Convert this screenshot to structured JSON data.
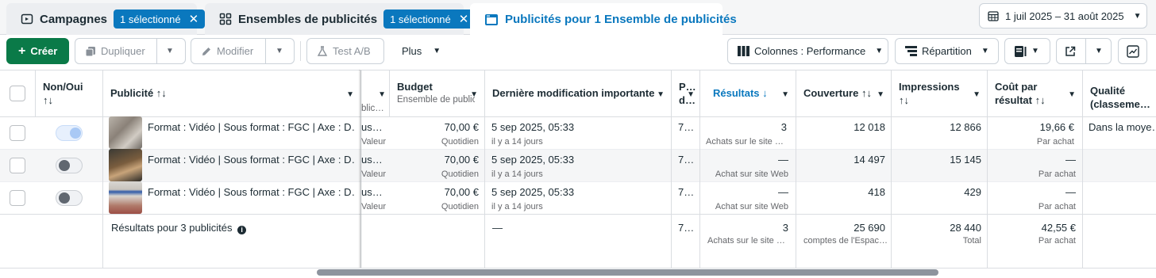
{
  "tabs": {
    "campaigns": {
      "label": "Campagnes",
      "chip": "1 sélectionné"
    },
    "adsets": {
      "label": "Ensembles de publicités",
      "chip": "1 sélectionné"
    },
    "ads": {
      "label": "Publicités pour 1 Ensemble de publicités"
    }
  },
  "date_range": "1 juil 2025 – 31 août 2025",
  "toolbar": {
    "create": "Créer",
    "duplicate": "Dupliquer",
    "edit": "Modifier",
    "ab_test": "Test A/B",
    "more": "Plus",
    "columns": "Colonnes : Performance",
    "breakdown": "Répartition"
  },
  "columns": {
    "onoff": "Non/Oui",
    "onoff_sort": "↑↓",
    "ad": "Publicité ↑↓",
    "hidden_sub": "blic…",
    "budget": "Budget",
    "budget_sub": "Ensemble de public…",
    "last_edit": "Dernière modification importante",
    "p_col_1": "P…",
    "p_col_2": "d…",
    "results": "Résultats ↓",
    "reach": "Couverture ↑↓",
    "impressions": "Impressions",
    "impressions_sort": "↑↓",
    "cost_per_result": "Coût par",
    "cost_per_result_2": "résultat ↑↓",
    "quality": "Qualité",
    "quality_2": "(classeme…"
  },
  "rows": [
    {
      "name": "Format : Vidéo | Sous format : FGC | Axe : D…",
      "hidden": "us…",
      "hidden_sub": "Valeur",
      "budget": "70,00 €",
      "budget_sub": "Quotidien",
      "last_edit": "5 sep 2025, 05:33",
      "last_edit_sub": "il y a 14 jours",
      "p_col": "7…",
      "results": "3",
      "results_sub": "Achats sur le site …",
      "reach": "12 018",
      "impressions": "12 866",
      "cpr": "19,66 €",
      "cpr_sub": "Par achat",
      "quality": "Dans la moye…",
      "on": true
    },
    {
      "name": "Format : Vidéo | Sous format : FGC | Axe : D…",
      "hidden": "us…",
      "hidden_sub": "Valeur",
      "budget": "70,00 €",
      "budget_sub": "Quotidien",
      "last_edit": "5 sep 2025, 05:33",
      "last_edit_sub": "il y a 14 jours",
      "p_col": "7…",
      "results": "—",
      "results_sub": "Achat sur site Web",
      "reach": "14 497",
      "impressions": "15 145",
      "cpr": "—",
      "cpr_sub": "Par achat",
      "quality": "",
      "on": false
    },
    {
      "name": "Format : Vidéo | Sous format : FGC | Axe : D…",
      "hidden": "us…",
      "hidden_sub": "Valeur",
      "budget": "70,00 €",
      "budget_sub": "Quotidien",
      "last_edit": "5 sep 2025, 05:33",
      "last_edit_sub": "il y a 14 jours",
      "p_col": "7…",
      "results": "—",
      "results_sub": "Achat sur site Web",
      "reach": "418",
      "impressions": "429",
      "cpr": "—",
      "cpr_sub": "Par achat",
      "quality": "",
      "on": false
    }
  ],
  "totals": {
    "label": "Résultats pour 3 publicités",
    "last_edit": "—",
    "p_col": "7…",
    "results": "3",
    "results_sub": "Achats sur le site …",
    "reach": "25 690",
    "reach_sub": "comptes de l'Espac…",
    "impressions": "28 440",
    "impressions_sub": "Total",
    "cpr": "42,55 €",
    "cpr_sub": "Par achat"
  },
  "colors": {
    "accent": "#0a78be",
    "create_green": "#0a7a48"
  }
}
